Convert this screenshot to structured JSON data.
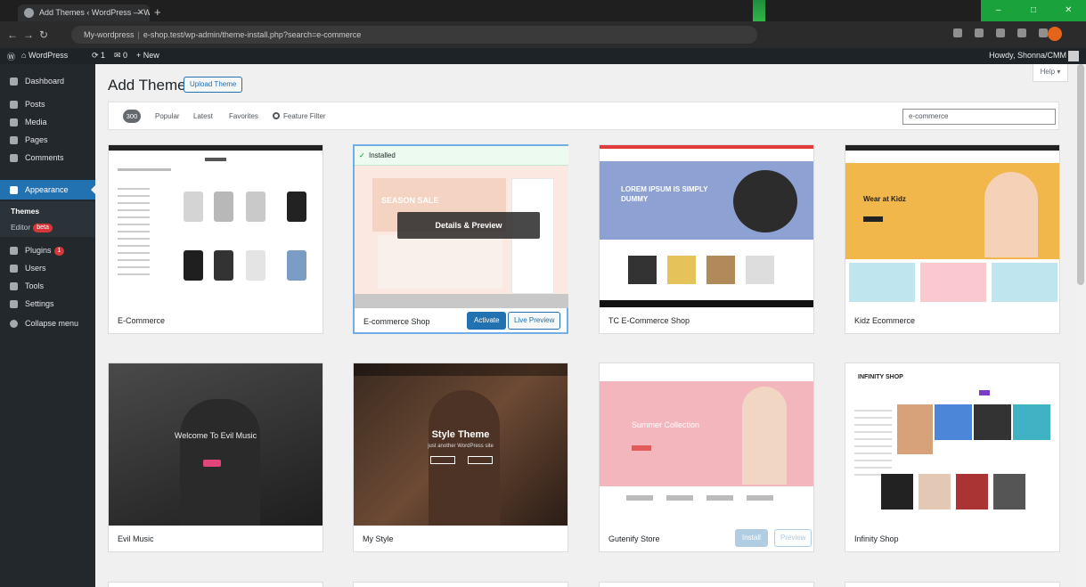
{
  "browser": {
    "tab_title": "Add Themes ‹ WordPress — W",
    "url_site": "My-wordpress",
    "url_sep": "|",
    "url_path": "e-shop.test/wp-admin/theme-install.php?search=e-commerce",
    "window_controls": [
      "–",
      "□",
      "✕"
    ]
  },
  "admin_bar": {
    "site_name": "WordPress",
    "updates": "1",
    "comments": "0",
    "new_label": "+ New",
    "howdy": "Howdy, Shonna/CMM"
  },
  "sidebar": {
    "items": [
      {
        "label": "Dashboard",
        "icon": "dashboard-icon"
      },
      {
        "label": "Posts",
        "icon": "pin-icon"
      },
      {
        "label": "Media",
        "icon": "media-icon"
      },
      {
        "label": "Pages",
        "icon": "page-icon"
      },
      {
        "label": "Comments",
        "icon": "comment-icon"
      },
      {
        "label": "Appearance",
        "icon": "brush-icon"
      },
      {
        "label": "Plugins",
        "icon": "plugin-icon",
        "badge": "1"
      },
      {
        "label": "Users",
        "icon": "user-icon"
      },
      {
        "label": "Tools",
        "icon": "wrench-icon"
      },
      {
        "label": "Settings",
        "icon": "settings-icon"
      },
      {
        "label": "Collapse menu",
        "icon": "collapse-icon"
      }
    ],
    "submenu": {
      "themes": "Themes",
      "editor": "Editor",
      "editor_badge": "beta"
    }
  },
  "header": {
    "title": "Add Themes",
    "upload_label": "Upload Theme",
    "help_label": "Help ▾"
  },
  "filters": {
    "count": "300",
    "popular": "Popular",
    "latest": "Latest",
    "favorites": "Favorites",
    "feature_filter": "Feature Filter",
    "search_value": "e-commerce"
  },
  "themes": [
    {
      "name": "E-Commerce"
    },
    {
      "name": "E-commerce Shop",
      "installed_label": "Installed",
      "overlay": "Details & Preview",
      "activate": "Activate",
      "live_preview": "Live Preview"
    },
    {
      "name": "TC E-Commerce Shop"
    },
    {
      "name": "Kidz Ecommerce"
    },
    {
      "name": "Evil Music"
    },
    {
      "name": "My Style"
    },
    {
      "name": "Gutenify Store",
      "btn1": "Install",
      "btn2": "Preview"
    },
    {
      "name": "Infinity Shop"
    }
  ],
  "previews": {
    "tc_hero": "LOREM IPSUM IS SIMPLY DUMMY",
    "kidz_hero": "Wear at Kidz",
    "evil_hero": "Welcome To Evil Music",
    "style_hero": "Style Theme",
    "style_sub": "just another WordPress site",
    "gutenify_hero": "Summer Collection",
    "infinity_logo": "INFINITY SHOP",
    "shop_banner": "SEASON SALE"
  }
}
